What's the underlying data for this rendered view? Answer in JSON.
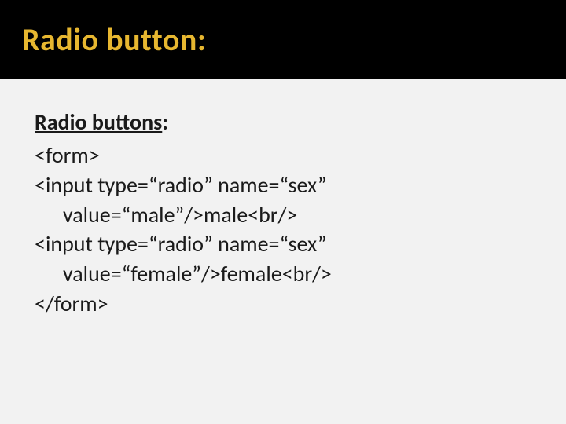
{
  "header": {
    "title": "Radio button:"
  },
  "body": {
    "subheading_underlined": "Radio buttons",
    "subheading_suffix": ":",
    "lines": {
      "l1": "<form>",
      "l2": "<input type=“radio” name=“sex”",
      "l3": "value=“male”/>male<br/>",
      "l4": "<input type=“radio” name=“sex”",
      "l5": "value=“female”/>female<br/>",
      "l6": "</form>"
    }
  }
}
